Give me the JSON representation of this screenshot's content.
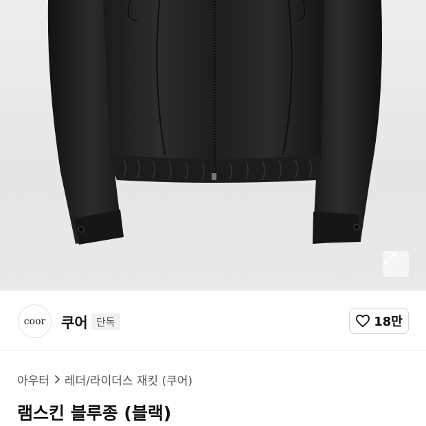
{
  "hero": {
    "image_alt": "black lambskin blouson jacket",
    "expand_icon": "expand-icon"
  },
  "brand": {
    "logo_text": "coor",
    "name": "쿠어",
    "badge": "단독"
  },
  "like": {
    "icon": "heart-icon",
    "count": "18만"
  },
  "breadcrumb": {
    "items": [
      "아우터",
      "레더/라이더스 재킷 (쿠어)"
    ],
    "separator_icon": "chevron-right-icon"
  },
  "product": {
    "title": "램스킨 블루종 (블랙)"
  }
}
